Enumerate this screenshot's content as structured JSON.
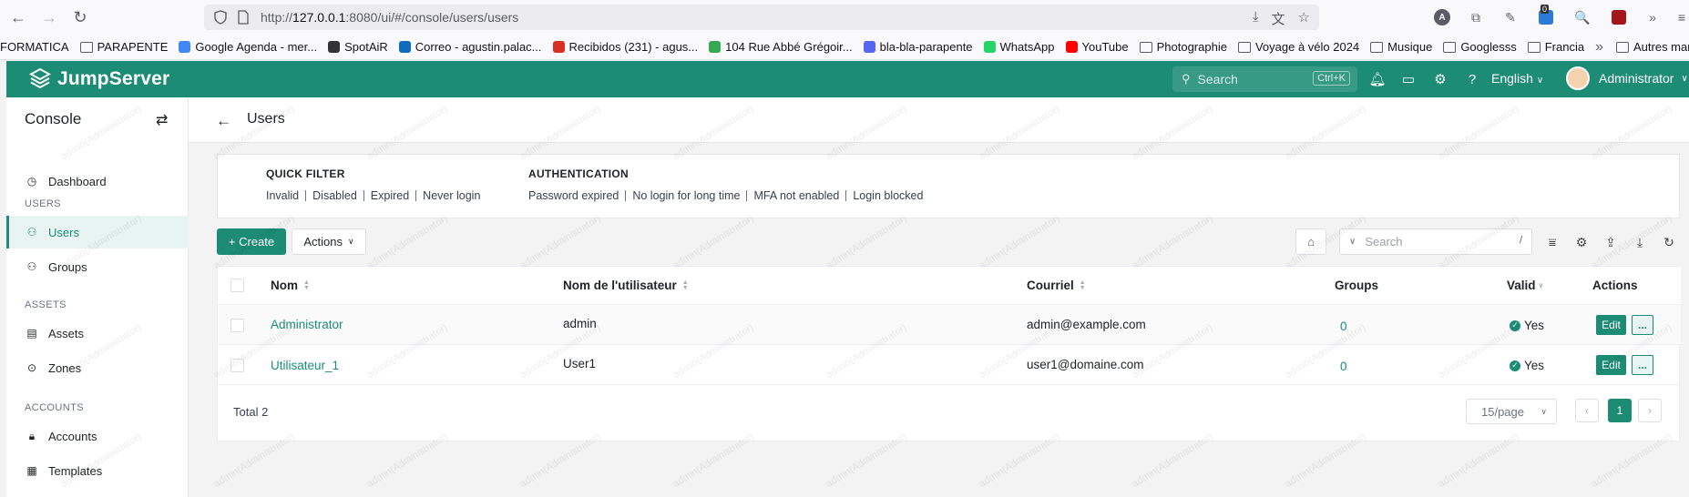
{
  "browser": {
    "url_prefix": "http://",
    "url_host": "127.0.0.1",
    "url_rest": ":8080/ui/#/console/users/users",
    "notif_count": "0"
  },
  "bookmarks": [
    "FORMATICA",
    "PARAPENTE",
    "Google Agenda - mer...",
    "SpotAiR",
    "Correo - agustin.palac...",
    "Recibidos (231) - agus...",
    "104 Rue Abbé Grégoir...",
    "bla-bla-parapente",
    "WhatsApp",
    "YouTube",
    "Photographie",
    "Voyage à vélo 2024",
    "Musique",
    "Googlesss",
    "Francia",
    "Autres marque-pag"
  ],
  "header": {
    "brand": "JumpServer",
    "search_placeholder": "Search",
    "search_shortcut": "Ctrl+K",
    "language": "English",
    "username": "Administrator"
  },
  "sidebar": {
    "title": "Console",
    "dashboard": "Dashboard",
    "sections": {
      "users": "USERS",
      "assets": "ASSETS",
      "accounts": "ACCOUNTS"
    },
    "items": {
      "users": "Users",
      "groups": "Groups",
      "assets": "Assets",
      "zones": "Zones",
      "accounts": "Accounts",
      "templates": "Templates"
    }
  },
  "page": {
    "title": "Users"
  },
  "filters": {
    "quick_title": "QUICK FILTER",
    "quick": [
      "Invalid",
      "Disabled",
      "Expired",
      "Never login"
    ],
    "auth_title": "AUTHENTICATION",
    "auth": [
      "Password expired",
      "No login for long time",
      "MFA not enabled",
      "Login blocked"
    ]
  },
  "toolbar": {
    "create": "+ Create",
    "actions": "Actions",
    "search_placeholder": "Search",
    "search_key": "/"
  },
  "table": {
    "columns": {
      "name": "Nom",
      "username": "Nom de l'utilisateur",
      "email": "Courriel",
      "groups": "Groups",
      "valid": "Valid",
      "actions": "Actions"
    },
    "rows": [
      {
        "name": "Administrator",
        "username": "admin",
        "email": "admin@example.com",
        "groups": "0",
        "valid": "Yes",
        "edit": "Edit",
        "more": "..."
      },
      {
        "name": "Utilisateur_1",
        "username": "User1",
        "email": "user1@domaine.com",
        "groups": "0",
        "valid": "Yes",
        "edit": "Edit",
        "more": "..."
      }
    ],
    "total": "Total 2",
    "page_size": "15/page",
    "current_page": "1"
  },
  "watermark": "admin(Administrator)",
  "colors": {
    "brand": "#1c8c75"
  }
}
